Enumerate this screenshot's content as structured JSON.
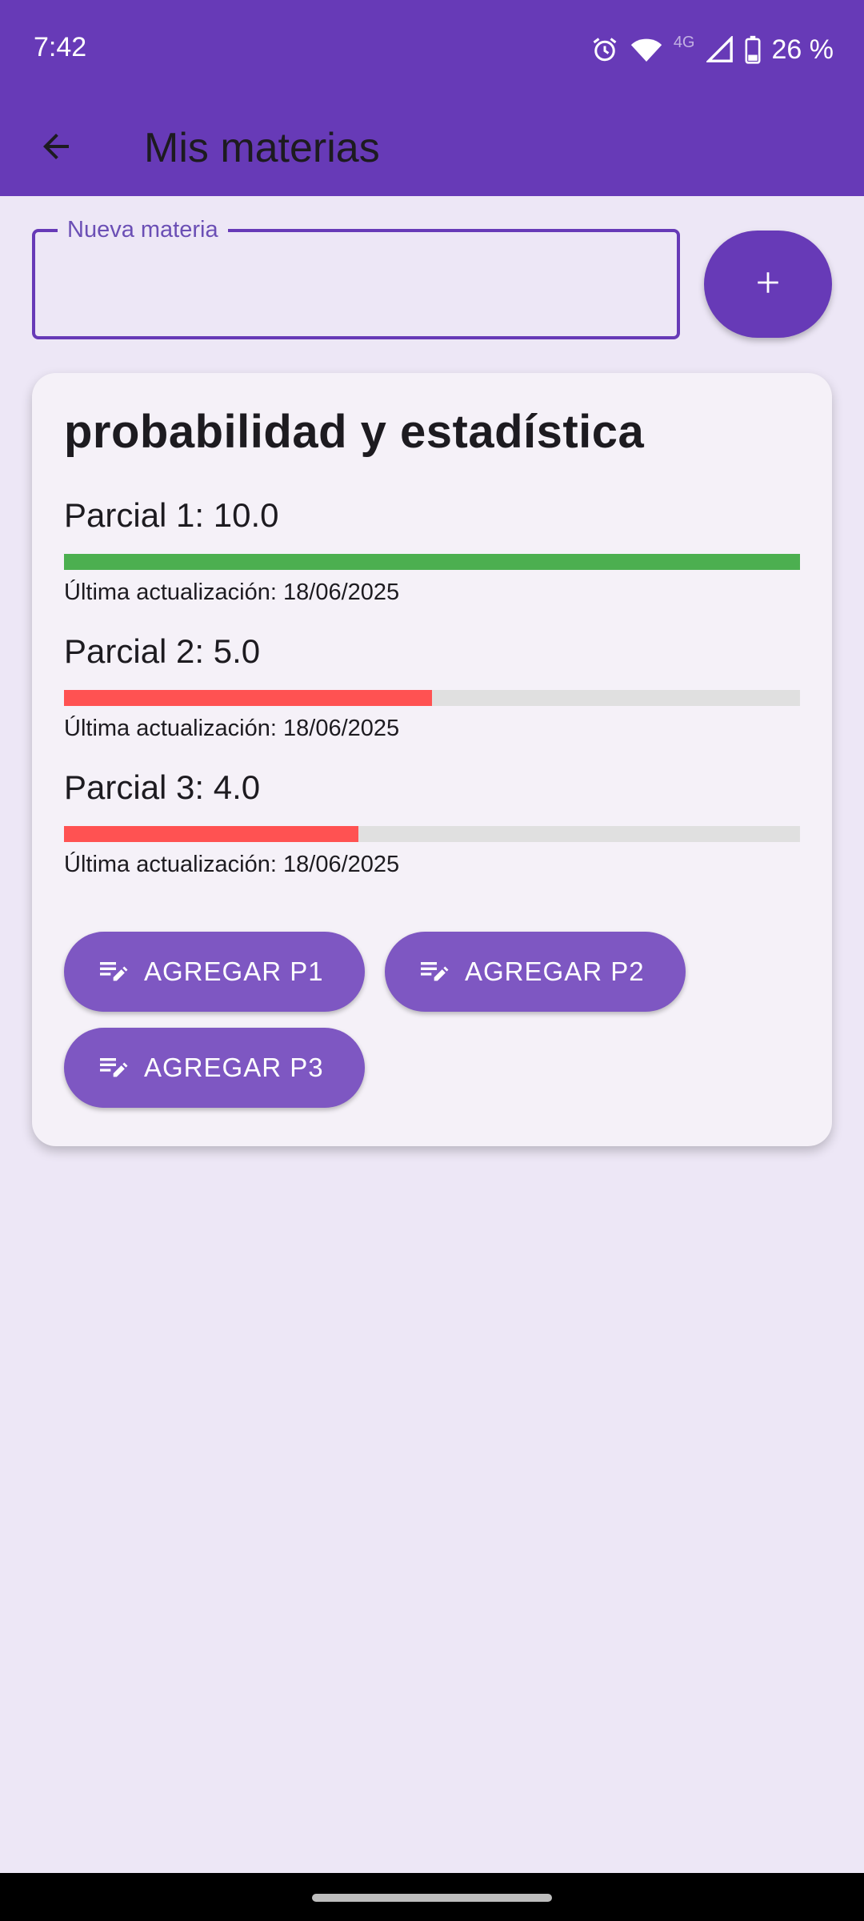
{
  "status_bar": {
    "time": "7:42",
    "network": "4G",
    "battery": "26 %",
    "icons": [
      "alarm-icon",
      "wifi-icon",
      "signal-icon",
      "battery-icon"
    ]
  },
  "app_bar": {
    "title": "Mis materias",
    "back_icon": "arrow-back-icon"
  },
  "input": {
    "label": "Nueva materia",
    "value": "",
    "add_icon": "plus-icon"
  },
  "subject": {
    "name": "probabilidad y estadística",
    "grades": [
      {
        "label": "Parcial 1: 10.0",
        "value": 10.0,
        "max": 10,
        "color": "#4caf50",
        "date": "Última actualización: 18/06/2025"
      },
      {
        "label": "Parcial 2: 5.0",
        "value": 5.0,
        "max": 10,
        "color": "#ff5252",
        "date": "Última actualización: 18/06/2025"
      },
      {
        "label": "Parcial 3: 4.0",
        "value": 4.0,
        "max": 10,
        "color": "#ff5252",
        "date": "Última actualización: 18/06/2025"
      }
    ],
    "actions": [
      {
        "label": "AGREGAR P1",
        "icon": "edit-note-icon"
      },
      {
        "label": "AGREGAR P2",
        "icon": "edit-note-icon"
      },
      {
        "label": "AGREGAR P3",
        "icon": "edit-note-icon"
      }
    ]
  },
  "colors": {
    "primary": "#673ab7",
    "button": "#7e57c2",
    "background": "#ede7f6",
    "card": "#f5f1f8"
  }
}
